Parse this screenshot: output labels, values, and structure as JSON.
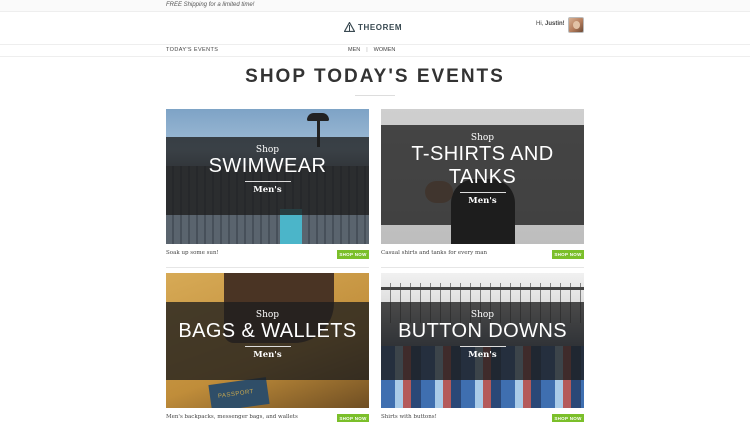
{
  "promo": {
    "text": "FREE Shipping for a limited time!"
  },
  "header": {
    "brand": "THEOREM",
    "greeting": "Hi,",
    "user_name": "Justin!"
  },
  "nav": {
    "events_label": "TODAY'S EVENTS",
    "men": "MEN",
    "separator": "|",
    "women": "WOMEN"
  },
  "page": {
    "title": "SHOP TODAY'S EVENTS"
  },
  "events": [
    {
      "shop": "Shop",
      "title": "SWIMWEAR",
      "gender": "Men's",
      "caption": "Soak up some sun!",
      "button": "SHOP NOW"
    },
    {
      "shop": "Shop",
      "title": "T-SHIRTS AND TANKS",
      "gender": "Men's",
      "caption": "Casual shirts and tanks for every man",
      "button": "SHOP NOW"
    },
    {
      "shop": "Shop",
      "title": "BAGS & WALLETS",
      "gender": "Men's",
      "caption": "Men's backpacks, messenger bags, and wallets",
      "button": "SHOP NOW"
    },
    {
      "shop": "Shop",
      "title": "BUTTON DOWNS",
      "gender": "Men's",
      "caption": "Shirts with buttons!",
      "button": "SHOP NOW"
    }
  ],
  "photo_text": {
    "passport": "PASSPORT"
  },
  "colors": {
    "accent": "#7bbf2a",
    "brand": "#3a4a52"
  }
}
